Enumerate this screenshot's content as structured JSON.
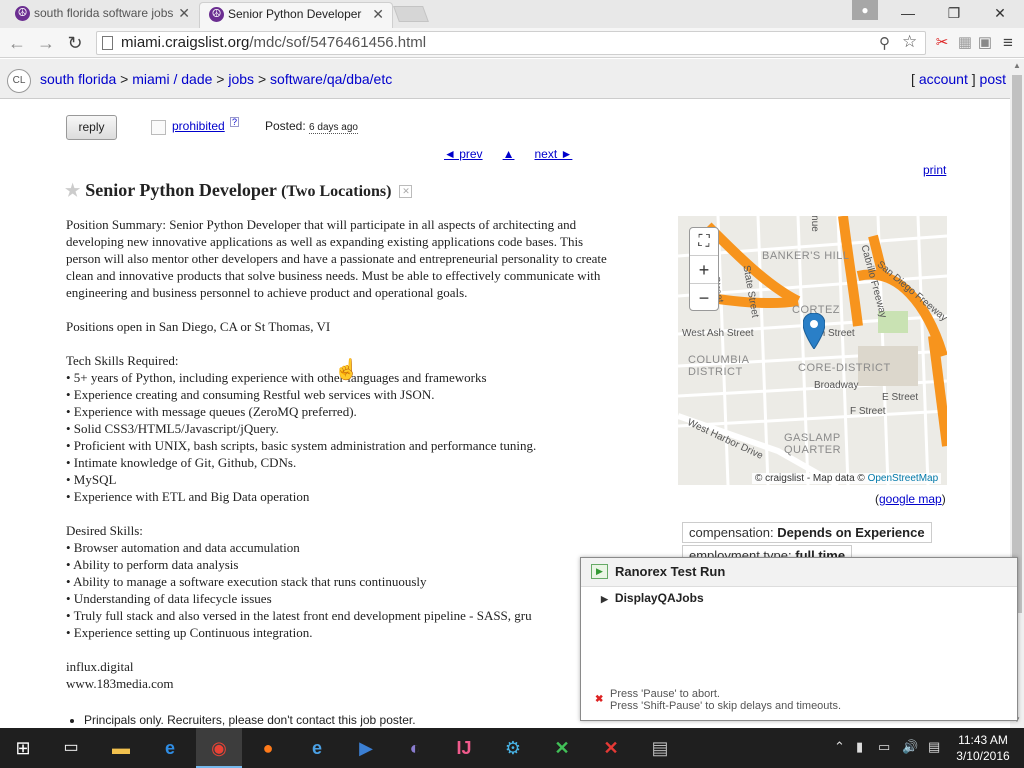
{
  "browser": {
    "tabs": [
      {
        "title": "south florida software jobs",
        "active": false
      },
      {
        "title": "Senior Python Developer",
        "active": true
      }
    ],
    "url_host": "miami.craigslist.org",
    "url_path": "/mdc/sof/5476461456.html",
    "window_controls": {
      "minimize": "—",
      "maximize": "❐",
      "close": "✕"
    }
  },
  "header": {
    "logo": "CL",
    "breadcrumbs": [
      "south florida",
      "miami / dade",
      "jobs",
      "software/qa/dba/etc"
    ],
    "separator": ">",
    "account_label": "account",
    "post_label": "post"
  },
  "posting": {
    "reply_label": "reply",
    "flag_label": "prohibited",
    "flag_help": "?",
    "posted_label": "Posted:",
    "posted_ago": "6 days ago",
    "prev_label": "◄ prev",
    "up_label": "▲",
    "next_label": "next ►",
    "print_label": "print",
    "title": "Senior Python Developer",
    "location": "(Two Locations)",
    "body_lines": [
      "Position Summary: Senior Python Developer that will participate in all aspects of architecting and",
      "developing new innovative applications as well as expanding existing applications code bases. This",
      "person will also mentor other developers and have a passionate and entrepreneurial personality to create",
      "clean and innovative products that solve business needs. Must be able to effectively communicate with",
      "engineering and business personnel to achieve product and operational goals.",
      "",
      "Positions open in San Diego, CA or St Thomas, VI",
      "",
      "Tech Skills Required:",
      "• 5+ years of Python, including experience with other languages and frameworks",
      "• Experience creating and consuming Restful web services with JSON.",
      "• Experience with message queues (ZeroMQ preferred).",
      "• Solid CSS3/HTML5/Javascript/jQuery.",
      "• Proficient with UNIX, bash scripts, basic system administration and performance tuning.",
      "• Intimate knowledge of Git, Github, CDNs.",
      "• MySQL",
      "• Experience with ETL and Big Data operation",
      "",
      "Desired Skills:",
      "• Browser automation and data accumulation",
      "• Ability to perform data analysis",
      "• Ability to manage a software execution stack that runs continuously",
      "• Understanding of data lifecycle issues",
      "• Truly full stack and also versed in the latest front end development pipeline - SASS, gru",
      "• Experience setting up Continuous integration.",
      "",
      "influx.digital",
      "www.183media.com"
    ],
    "notice": "Principals only. Recruiters, please don't contact this job poster.",
    "map": {
      "attribution": "© craigslist - Map data ©",
      "osm": "OpenStreetMap",
      "labels": [
        "BANKER'S HILL",
        "CORTEZ",
        "Ash Street",
        "West Ash Street",
        "COLUMBIA DISTRICT",
        "CORE-DISTRICT",
        "Broadway",
        "E Street",
        "F Street",
        "West Harbor Drive",
        "GASLAMP QUARTER",
        "Cabrillo Freeway",
        "San Diego Freeway",
        "State Street",
        "nue",
        "Street"
      ],
      "google_map_label": "google map",
      "controls": {
        "fullscreen": "⛶",
        "zoom_in": "+",
        "zoom_out": "−"
      }
    },
    "attributes": [
      {
        "label": "compensation:",
        "value": "Depends on Experience"
      },
      {
        "label": "employment type:",
        "value": "full time"
      }
    ]
  },
  "ranorex": {
    "title": "Ranorex Test Run",
    "item": "DisplayQAJobs",
    "footer_lines": [
      "Press 'Pause' to abort.",
      "Press 'Shift-Pause' to skip delays and timeouts."
    ]
  },
  "taskbar": {
    "time": "11:43 AM",
    "date": "3/10/2016"
  },
  "colors": {
    "link": "#0000cc",
    "map_freeway": "#f7941d",
    "marker": "#2a7fc7"
  }
}
